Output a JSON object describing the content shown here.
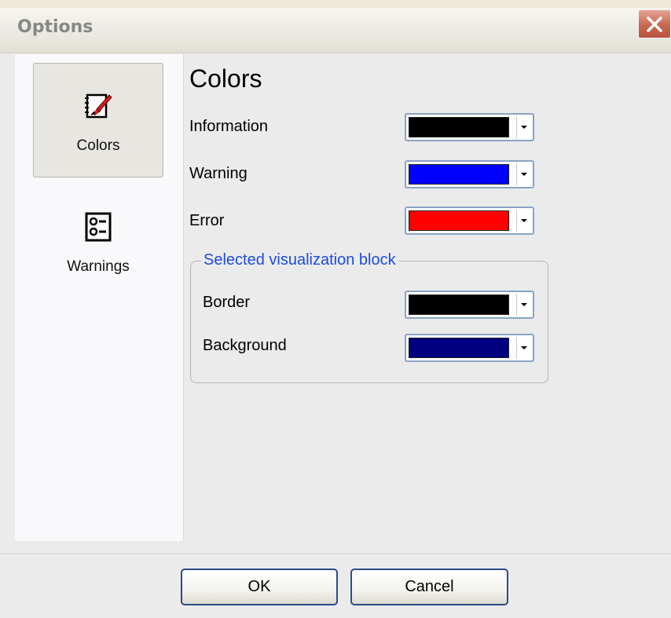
{
  "window": {
    "title": "Options"
  },
  "sidebar": {
    "items": [
      {
        "label": "Colors",
        "icon": "palette-brush-icon",
        "selected": true
      },
      {
        "label": "Warnings",
        "icon": "checklist-icon",
        "selected": false
      }
    ]
  },
  "main": {
    "title": "Colors",
    "rows": [
      {
        "label": "Information",
        "color": "#000000"
      },
      {
        "label": "Warning",
        "color": "#0000ff"
      },
      {
        "label": "Error",
        "color": "#ff0000"
      }
    ],
    "group": {
      "legend": "Selected visualization block",
      "rows": [
        {
          "label": "Border",
          "color": "#000000"
        },
        {
          "label": "Background",
          "color": "#000080"
        }
      ]
    }
  },
  "buttons": {
    "ok": "OK",
    "cancel": "Cancel"
  },
  "theme": {
    "legend_color": "#1c4be0",
    "close_button_color": "#c9674f"
  }
}
